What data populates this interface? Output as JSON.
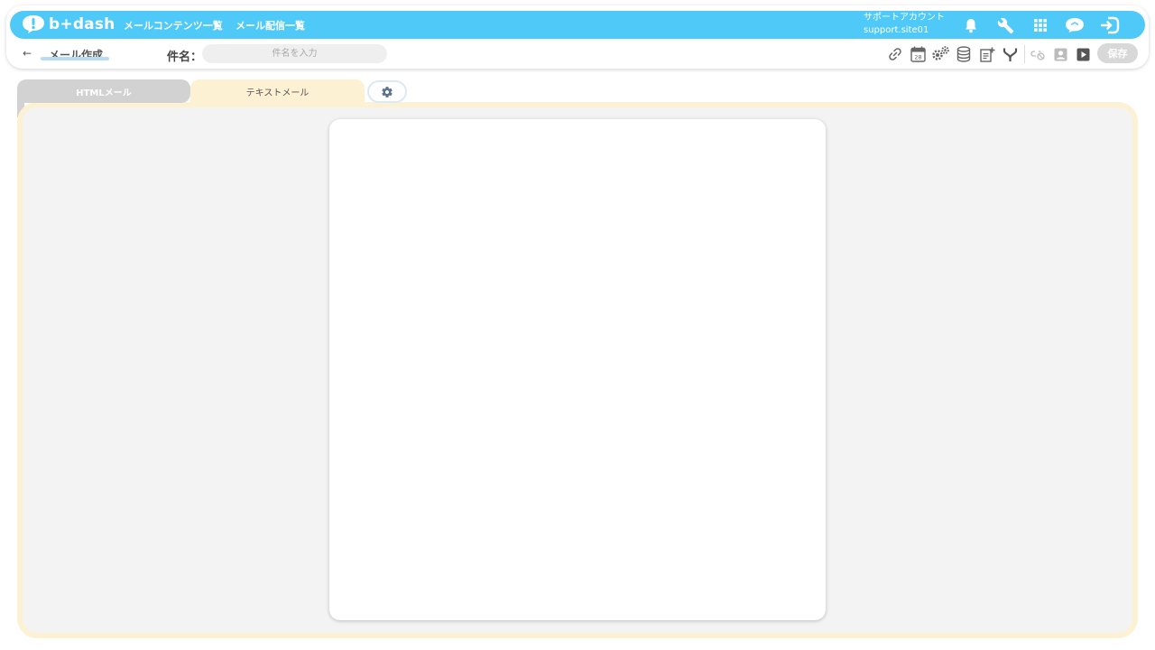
{
  "header": {
    "logo_text": "b+dash",
    "nav": [
      {
        "label": "メールコンテンツ一覧"
      },
      {
        "label": "メール配信一覧"
      }
    ],
    "account": {
      "name": "サポートアカウント",
      "id": "support.site01"
    },
    "icons": [
      "bell-icon",
      "wrench-icon",
      "apps-grid-icon",
      "chat-cloud-icon",
      "logout-icon"
    ]
  },
  "editor_toolbar": {
    "page_title": "メール作成",
    "subject_label": "件名：",
    "subject_value": "",
    "subject_placeholder": "件名を入力",
    "calendar_day": "28",
    "save_label": "保存",
    "tools": [
      "link-icon",
      "calendar-icon",
      "gears-icon",
      "database-icon",
      "add-document-icon",
      "merge-icon",
      "link-disabled-icon",
      "contact-card-icon",
      "play-icon"
    ]
  },
  "tabs": [
    {
      "label": "HTMLメール",
      "active": false
    },
    {
      "label": "テキストメール",
      "active": true
    }
  ],
  "colors": {
    "brand": "#4ec9f8",
    "active_tab": "#fdf1d3",
    "inactive_tab": "#d2d2d2"
  },
  "editor": {
    "content": ""
  }
}
